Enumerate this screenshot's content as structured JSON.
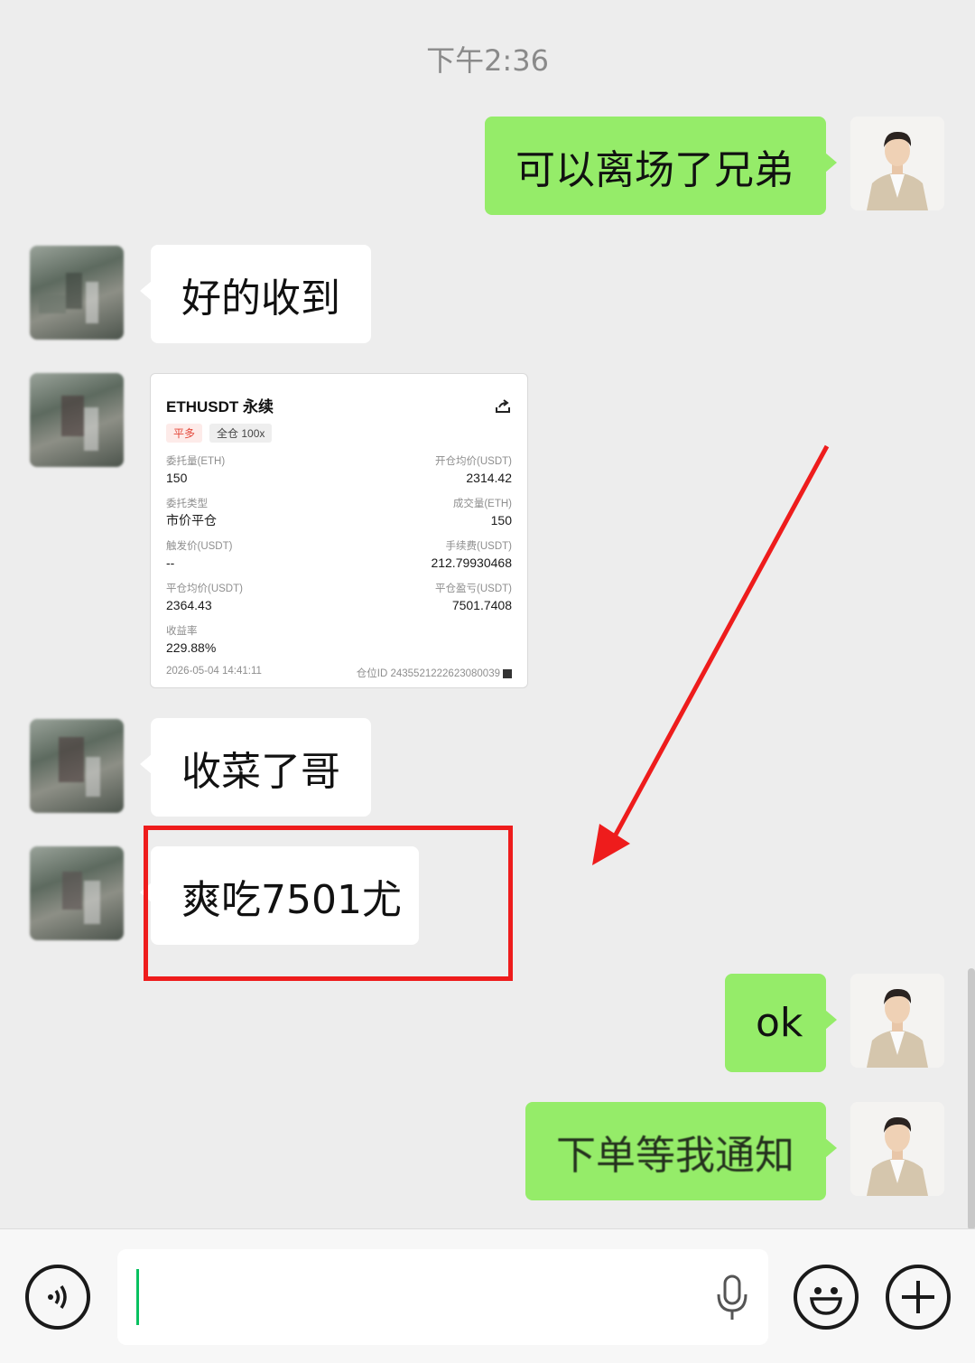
{
  "chat": {
    "timestamp": "下午2:36",
    "messages": [
      {
        "sender": "self",
        "text": "可以离场了兄弟"
      },
      {
        "sender": "other",
        "text": "好的收到"
      },
      {
        "sender": "other",
        "text": "收菜了哥"
      },
      {
        "sender": "other",
        "text": "爽吃7501尤"
      },
      {
        "sender": "self",
        "text": "ok"
      },
      {
        "sender": "self",
        "text": "下单等我通知"
      }
    ]
  },
  "trade_card": {
    "title": "ETHUSDT 永续",
    "tag_side": "平多",
    "tag_margin": "全仓 100x",
    "fields": {
      "order_qty_label": "委托量(ETH)",
      "order_qty": "150",
      "open_avg_label": "开仓均价(USDT)",
      "open_avg": "2314.42",
      "order_type_label": "委托类型",
      "order_type": "市价平仓",
      "filled_qty_label": "成交量(ETH)",
      "filled_qty": "150",
      "trigger_label": "触发价(USDT)",
      "trigger": "--",
      "fee_label": "手续费(USDT)",
      "fee": "212.79930468",
      "close_avg_label": "平仓均价(USDT)",
      "close_avg": "2364.43",
      "pnl_label": "平仓盈亏(USDT)",
      "pnl": "7501.7408",
      "roi_label": "收益率",
      "roi": "229.88%"
    },
    "datetime": "2026-05-04 14:41:11",
    "position_id": "仓位ID 2435521222623080039"
  },
  "input_bar": {
    "voice_icon": "voice-toggle-icon",
    "mic_icon": "microphone-icon",
    "emoji_icon": "emoji-icon",
    "plus_icon": "plus-icon"
  },
  "colors": {
    "self_bubble": "#95ec69",
    "other_bubble": "#ffffff",
    "background": "#ededed",
    "annotation": "#ee1c1c"
  }
}
